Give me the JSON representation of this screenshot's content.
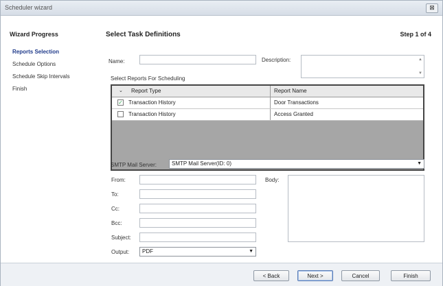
{
  "window": {
    "title": "Scheduler wizard",
    "close_glyph": "⊠"
  },
  "sidebar": {
    "heading": "Wizard Progress",
    "items": [
      {
        "label": "Reports Selection",
        "active": true
      },
      {
        "label": "Schedule Options",
        "active": false
      },
      {
        "label": "Schedule Skip Intervals",
        "active": false
      },
      {
        "label": "Finish",
        "active": false
      }
    ]
  },
  "main": {
    "title": "Select Task Definitions",
    "step": "Step 1 of 4",
    "name_label": "Name:",
    "name_value": "",
    "description_label": "Description:",
    "description_value": "",
    "reports_label": "Select Reports For Scheduling",
    "grid": {
      "columns": [
        "Report Type",
        "Report Name"
      ],
      "rows": [
        {
          "checked": true,
          "type": "Transaction History",
          "name": "Door Transactions"
        },
        {
          "checked": false,
          "type": "Transaction History",
          "name": "Access Granted"
        }
      ]
    },
    "smtp_label": "SMTP Mail Server:",
    "smtp_value": "SMTP Mail Server(ID: 0)",
    "from_label": "From:",
    "to_label": "To:",
    "cc_label": "Cc:",
    "bcc_label": "Bcc:",
    "subject_label": "Subject:",
    "output_label": "Output:",
    "output_value": "PDF",
    "body_label": "Body:"
  },
  "footer": {
    "back": "< Back",
    "next": "Next >",
    "cancel": "Cancel",
    "finish": "Finish"
  }
}
